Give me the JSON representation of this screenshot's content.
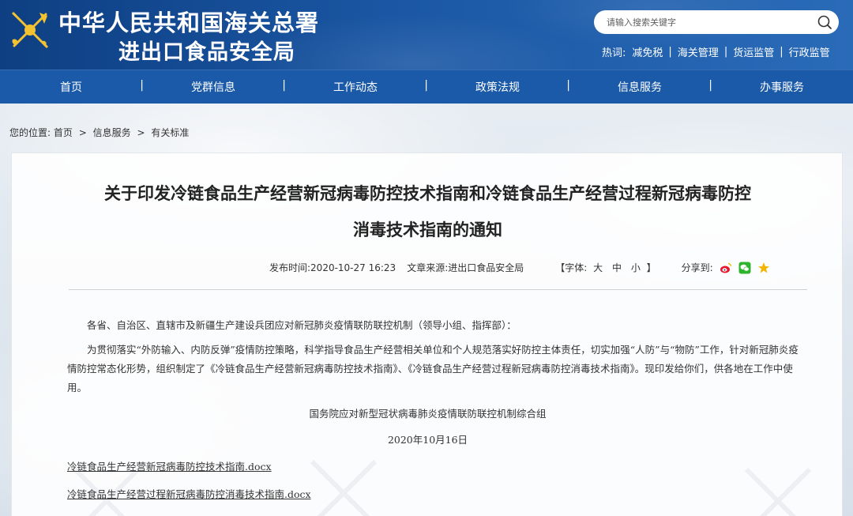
{
  "header": {
    "title_line1": "中华人民共和国海关总署",
    "title_line2": "进出口食品安全局",
    "search_placeholder": "请输入搜索关键字",
    "hot_label": "热词:",
    "hot_words": [
      "减免税",
      "海关管理",
      "货运监管",
      "行政监管"
    ]
  },
  "nav": {
    "items": [
      "首页",
      "党群信息",
      "工作动态",
      "政策法规",
      "信息服务",
      "办事服务"
    ]
  },
  "breadcrumb": {
    "prefix": "您的位置:",
    "items": [
      "首页",
      "信息服务",
      "有关标准"
    ]
  },
  "article": {
    "title_line1": "关于印发冷链食品生产经营新冠病毒防控技术指南和冷链食品生产经营过程新冠病毒防控",
    "title_line2": "消毒技术指南的通知",
    "publish_label": "发布时间:",
    "publish_time": "2020-10-27 16:23",
    "source_label": "文章来源:",
    "source": "进出口食品安全局",
    "font_prefix": "【字体:",
    "font_large": "大",
    "font_medium": "中",
    "font_small": "小",
    "font_suffix": "】",
    "share_label": "分享到:",
    "para1": "各省、自治区、直辖市及新疆生产建设兵团应对新冠肺炎疫情联防联控机制（领导小组、指挥部）：",
    "para2": "为贯彻落实“外防输入、内防反弹”疫情防控策略，科学指导食品生产经营相关单位和个人规范落实好防控主体责任，切实加强“人防”与“物防”工作，针对新冠肺炎疫情防控常态化形势，组织制定了《冷链食品生产经营新冠病毒防控技术指南》、《冷链食品生产经营过程新冠病毒防控消毒技术指南》。现印发给你们，供各地在工作中使用。",
    "signer": "国务院应对新型冠状病毒肺炎疫情联防联控机制综合组",
    "date": "2020年10月16日",
    "attachments": [
      "冷链食品生产经营新冠病毒防控技术指南.docx",
      "冷链食品生产经营过程新冠病毒防控消毒技术指南.docx"
    ]
  },
  "colors": {
    "header_blue": "#0e3f82",
    "nav_blue": "#1b5aa8",
    "weibo_red": "#e6162d",
    "wechat_green": "#2fb52d",
    "fav_yellow": "#f2b500"
  },
  "icons": [
    "customs-emblem-icon",
    "search-icon",
    "weibo-icon",
    "wechat-icon",
    "favorite-star-icon"
  ]
}
